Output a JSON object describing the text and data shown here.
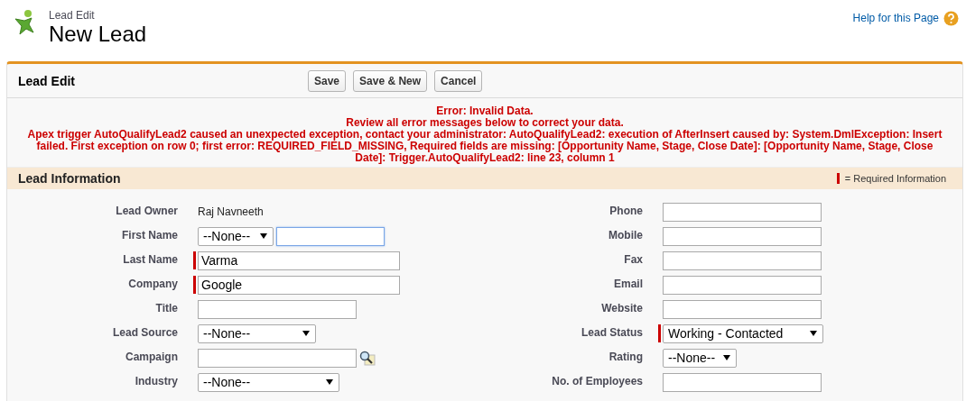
{
  "header": {
    "subtitle": "Lead Edit",
    "title": "New Lead",
    "help_link": "Help for this Page"
  },
  "toolbar": {
    "title": "Lead Edit",
    "buttons": [
      "Save",
      "Save & New",
      "Cancel"
    ]
  },
  "error": {
    "title": "Error: Invalid Data.",
    "lines": [
      "Review all error messages below to correct your data.",
      "Apex trigger AutoQualifyLead2 caused an unexpected exception, contact your administrator: AutoQualifyLead2: execution of AfterInsert caused by: System.DmlException: Insert failed. First exception on row 0; first error: REQUIRED_FIELD_MISSING, Required fields are missing: [Opportunity Name, Stage, Close Date]: [Opportunity Name, Stage, Close Date]: Trigger.AutoQualifyLead2: line 23, column 1"
    ]
  },
  "section": {
    "title": "Lead Information",
    "legend": "= Required Information"
  },
  "left_fields": [
    {
      "label": "Lead Owner",
      "kind": "text",
      "value": "Raj Navneeth",
      "required": false
    },
    {
      "label": "First Name",
      "kind": "name",
      "value": "--None--",
      "required": false,
      "focused": true
    },
    {
      "label": "Last Name",
      "kind": "input",
      "value": "Varma",
      "required": true
    },
    {
      "label": "Company",
      "kind": "input",
      "value": "Google",
      "required": true
    },
    {
      "label": "Title",
      "kind": "input",
      "required": false
    },
    {
      "label": "Lead Source",
      "kind": "select",
      "value": "--None--",
      "required": false
    },
    {
      "label": "Campaign",
      "kind": "lookup",
      "required": false
    },
    {
      "label": "Industry",
      "kind": "select",
      "value": "--None--",
      "required": false
    }
  ],
  "right_fields": [
    {
      "label": "Phone",
      "kind": "input",
      "required": false
    },
    {
      "label": "Mobile",
      "kind": "input",
      "required": false
    },
    {
      "label": "Fax",
      "kind": "input",
      "required": false
    },
    {
      "label": "Email",
      "kind": "input",
      "required": false
    },
    {
      "label": "Website",
      "kind": "input",
      "required": false
    },
    {
      "label": "Lead Status",
      "kind": "select",
      "value": "Working - Contacted",
      "required": true
    },
    {
      "label": "Rating",
      "kind": "select",
      "value": "--None--",
      "required": false
    },
    {
      "label": "No. of Employees",
      "kind": "input",
      "required": false
    }
  ]
}
